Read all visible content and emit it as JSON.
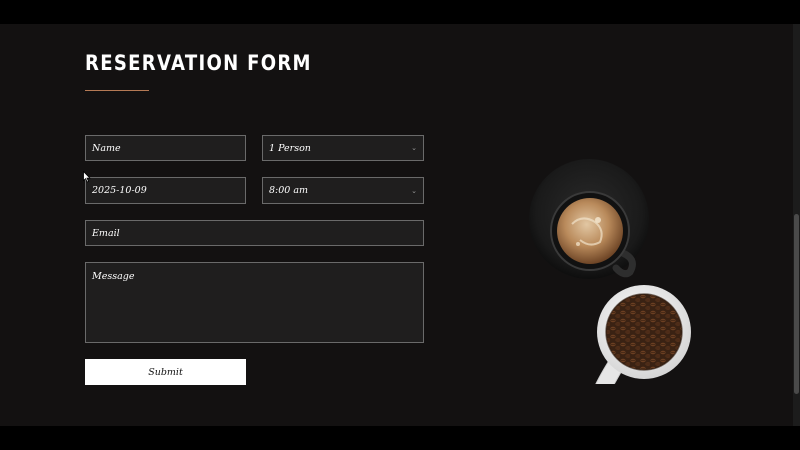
{
  "form": {
    "title": "RESERVATION FORM",
    "name_placeholder": "Name",
    "party_size": "1 Person",
    "date": "2025-10-09",
    "time": "8:00 am",
    "email_placeholder": "Email",
    "message_placeholder": "Message",
    "submit_label": "Submit"
  },
  "colors": {
    "background": "#131111",
    "accent_rule": "#b57a55",
    "field_bg": "#1f1e1e",
    "field_border": "#6a6a6a",
    "button_bg": "#ffffff"
  },
  "icons": {
    "select_arrow": "chevron-down-icon",
    "pointer": "mouse-cursor-icon"
  },
  "images": {
    "coffee": "coffee-cups-illustration"
  }
}
